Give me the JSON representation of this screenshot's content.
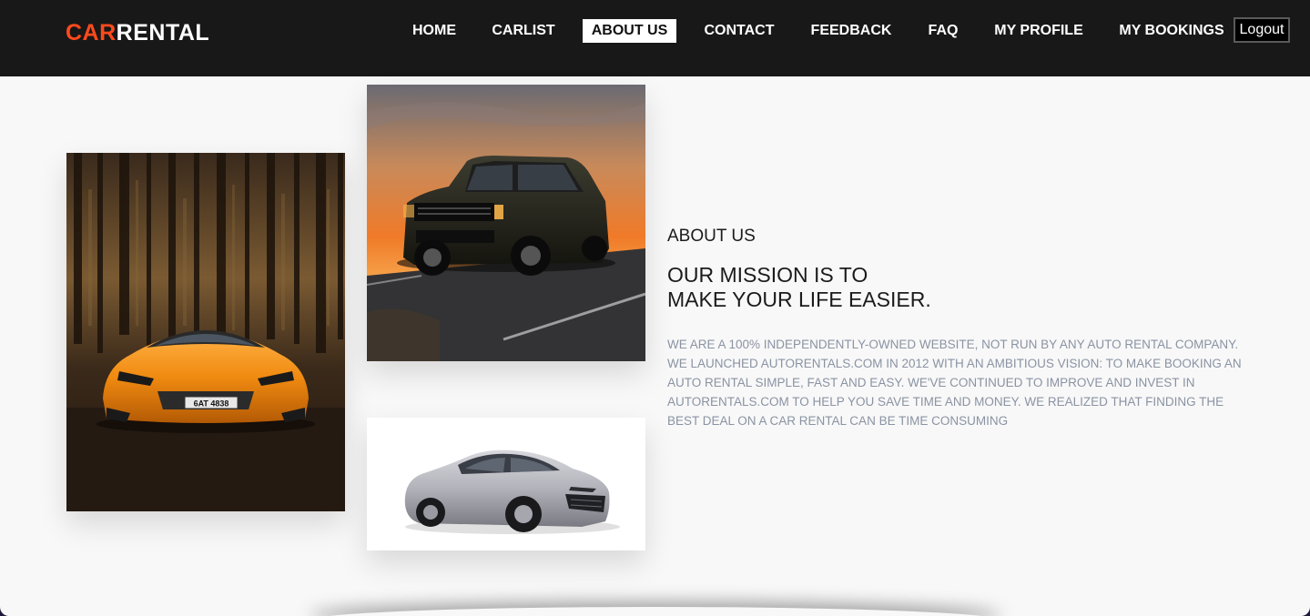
{
  "brand": {
    "accent": "CAR",
    "rest": "RENTAL"
  },
  "nav": {
    "items": [
      {
        "label": "HOME"
      },
      {
        "label": "CARLIST"
      },
      {
        "label": "ABOUT US",
        "active": true
      },
      {
        "label": "CONTACT"
      },
      {
        "label": "FEEDBACK"
      },
      {
        "label": "FAQ"
      },
      {
        "label": "MY PROFILE"
      },
      {
        "label": "MY BOOKINGS"
      }
    ],
    "logout": "Logout"
  },
  "about": {
    "kicker": "ABOUT US",
    "title_line1": "OUR MISSION IS TO",
    "title_line2": "MAKE YOUR LIFE EASIER.",
    "body": "WE ARE A 100% INDEPENDENTLY-OWNED WEBSITE, NOT RUN BY ANY AUTO RENTAL COMPANY. WE LAUNCHED AUTORENTALS.COM IN 2012 WITH AN AMBITIOUS VISION: TO MAKE BOOKING AN AUTO RENTAL SIMPLE, FAST AND EASY. WE'VE CONTINUED TO IMPROVE AND INVEST IN AUTORENTALS.COM TO HELP YOU SAVE TIME AND MONEY. WE REALIZED THAT FINDING THE BEST DEAL ON A CAR RENTAL CAN BE TIME CONSUMING"
  },
  "photos": {
    "orange_plate": "6AT 4838"
  },
  "colors": {
    "nav_bg": "#181818",
    "brand_accent": "#ff4a1c",
    "page_bg": "#f8f8f8",
    "body_text": "#8a93a3"
  }
}
